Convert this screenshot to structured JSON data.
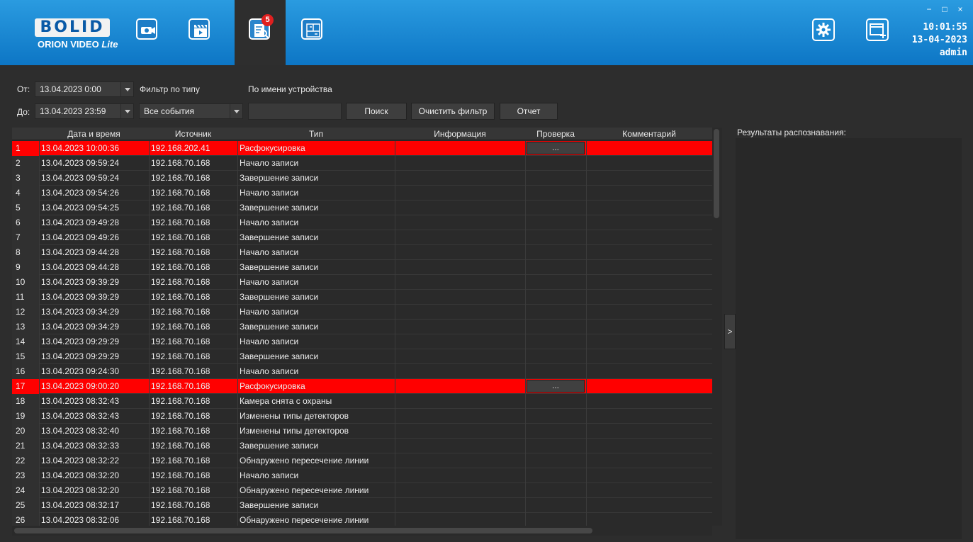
{
  "header": {
    "logo_brand": "BOLID",
    "logo_product": "ORION VIDEO",
    "logo_edition": "Lite",
    "nav": [
      {
        "icon": "camera-icon",
        "active": false
      },
      {
        "icon": "clapperboard-icon",
        "active": false
      },
      {
        "icon": "event-log-icon",
        "active": true,
        "badge": "5"
      },
      {
        "icon": "layout-icon",
        "active": false
      }
    ],
    "clock_time": "10:01:55",
    "clock_date": "13-04-2023",
    "user": "admin",
    "win_minimize": "−",
    "win_maximize": "□",
    "win_close": "×",
    "accent": "#1a86d2"
  },
  "filter": {
    "from_label": "От:",
    "from_value": "13.04.2023 0:00",
    "to_label": "До:",
    "to_value": "13.04.2023 23:59",
    "type_label": "Фильтр по типу",
    "type_value": "Все события",
    "device_label": "По имени устройства",
    "device_value": "",
    "search_button": "Поиск",
    "clear_button": "Очистить фильтр",
    "report_button": "Отчет"
  },
  "table": {
    "columns": [
      "",
      "Дата и время",
      "Источник",
      "Тип",
      "Информация",
      "Проверка",
      "Комментарий"
    ],
    "check_button_label": "...",
    "alert_color": "#ff0000",
    "rows": [
      {
        "n": "1",
        "time": "13.04.2023 10:00:36",
        "src": "192.168.202.41",
        "type": "Расфокусировка",
        "alert": true
      },
      {
        "n": "2",
        "time": "13.04.2023 09:59:24",
        "src": "192.168.70.168",
        "type": "Начало записи",
        "alert": false
      },
      {
        "n": "3",
        "time": "13.04.2023 09:59:24",
        "src": "192.168.70.168",
        "type": "Завершение записи",
        "alert": false
      },
      {
        "n": "4",
        "time": "13.04.2023 09:54:26",
        "src": "192.168.70.168",
        "type": "Начало записи",
        "alert": false
      },
      {
        "n": "5",
        "time": "13.04.2023 09:54:25",
        "src": "192.168.70.168",
        "type": "Завершение записи",
        "alert": false
      },
      {
        "n": "6",
        "time": "13.04.2023 09:49:28",
        "src": "192.168.70.168",
        "type": "Начало записи",
        "alert": false
      },
      {
        "n": "7",
        "time": "13.04.2023 09:49:26",
        "src": "192.168.70.168",
        "type": "Завершение записи",
        "alert": false
      },
      {
        "n": "8",
        "time": "13.04.2023 09:44:28",
        "src": "192.168.70.168",
        "type": "Начало записи",
        "alert": false
      },
      {
        "n": "9",
        "time": "13.04.2023 09:44:28",
        "src": "192.168.70.168",
        "type": "Завершение записи",
        "alert": false
      },
      {
        "n": "10",
        "time": "13.04.2023 09:39:29",
        "src": "192.168.70.168",
        "type": "Начало записи",
        "alert": false
      },
      {
        "n": "11",
        "time": "13.04.2023 09:39:29",
        "src": "192.168.70.168",
        "type": "Завершение записи",
        "alert": false
      },
      {
        "n": "12",
        "time": "13.04.2023 09:34:29",
        "src": "192.168.70.168",
        "type": "Начало записи",
        "alert": false
      },
      {
        "n": "13",
        "time": "13.04.2023 09:34:29",
        "src": "192.168.70.168",
        "type": "Завершение записи",
        "alert": false
      },
      {
        "n": "14",
        "time": "13.04.2023 09:29:29",
        "src": "192.168.70.168",
        "type": "Начало записи",
        "alert": false
      },
      {
        "n": "15",
        "time": "13.04.2023 09:29:29",
        "src": "192.168.70.168",
        "type": "Завершение записи",
        "alert": false
      },
      {
        "n": "16",
        "time": "13.04.2023 09:24:30",
        "src": "192.168.70.168",
        "type": "Начало записи",
        "alert": false
      },
      {
        "n": "17",
        "time": "13.04.2023 09:00:20",
        "src": "192.168.70.168",
        "type": "Расфокусировка",
        "alert": true
      },
      {
        "n": "18",
        "time": "13.04.2023 08:32:43",
        "src": "192.168.70.168",
        "type": "Камера снята с охраны",
        "alert": false
      },
      {
        "n": "19",
        "time": "13.04.2023 08:32:43",
        "src": "192.168.70.168",
        "type": "Изменены типы детекторов",
        "alert": false
      },
      {
        "n": "20",
        "time": "13.04.2023 08:32:40",
        "src": "192.168.70.168",
        "type": "Изменены типы детекторов",
        "alert": false
      },
      {
        "n": "21",
        "time": "13.04.2023 08:32:33",
        "src": "192.168.70.168",
        "type": "Завершение записи",
        "alert": false
      },
      {
        "n": "22",
        "time": "13.04.2023 08:32:22",
        "src": "192.168.70.168",
        "type": "Обнаружено пересечение линии",
        "alert": false
      },
      {
        "n": "23",
        "time": "13.04.2023 08:32:20",
        "src": "192.168.70.168",
        "type": "Начало записи",
        "alert": false
      },
      {
        "n": "24",
        "time": "13.04.2023 08:32:20",
        "src": "192.168.70.168",
        "type": "Обнаружено пересечение линии",
        "alert": false
      },
      {
        "n": "25",
        "time": "13.04.2023 08:32:17",
        "src": "192.168.70.168",
        "type": "Завершение записи",
        "alert": false
      },
      {
        "n": "26",
        "time": "13.04.2023 08:32:06",
        "src": "192.168.70.168",
        "type": "Обнаружено пересечение линии",
        "alert": false
      }
    ]
  },
  "side": {
    "expand_label": ">",
    "results_title": "Результаты распознавания:"
  }
}
